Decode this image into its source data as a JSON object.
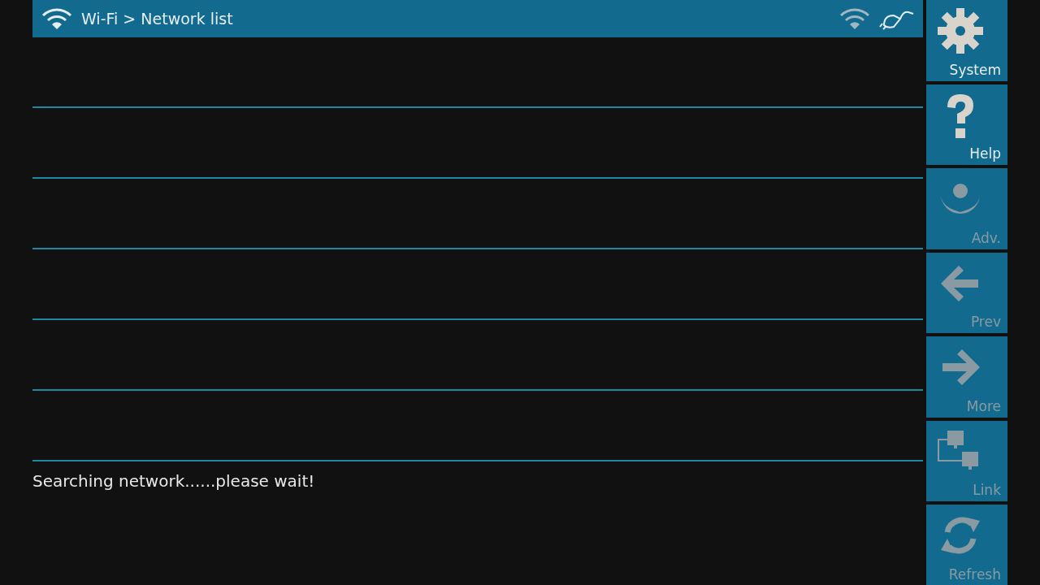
{
  "header": {
    "title": "Wi-Fi > Network list"
  },
  "status_message": "Searching network......please wait!",
  "sidebar": {
    "buttons": [
      {
        "kind": "system",
        "label": "System",
        "disabled": false
      },
      {
        "kind": "help",
        "label": "Help",
        "disabled": false
      },
      {
        "kind": "adv",
        "label": "Adv.",
        "disabled": true
      },
      {
        "kind": "prev",
        "label": "Prev",
        "disabled": true
      },
      {
        "kind": "more",
        "label": "More",
        "disabled": true
      },
      {
        "kind": "link",
        "label": "Link",
        "disabled": true
      },
      {
        "kind": "refresh",
        "label": "Refresh",
        "disabled": true
      }
    ]
  }
}
